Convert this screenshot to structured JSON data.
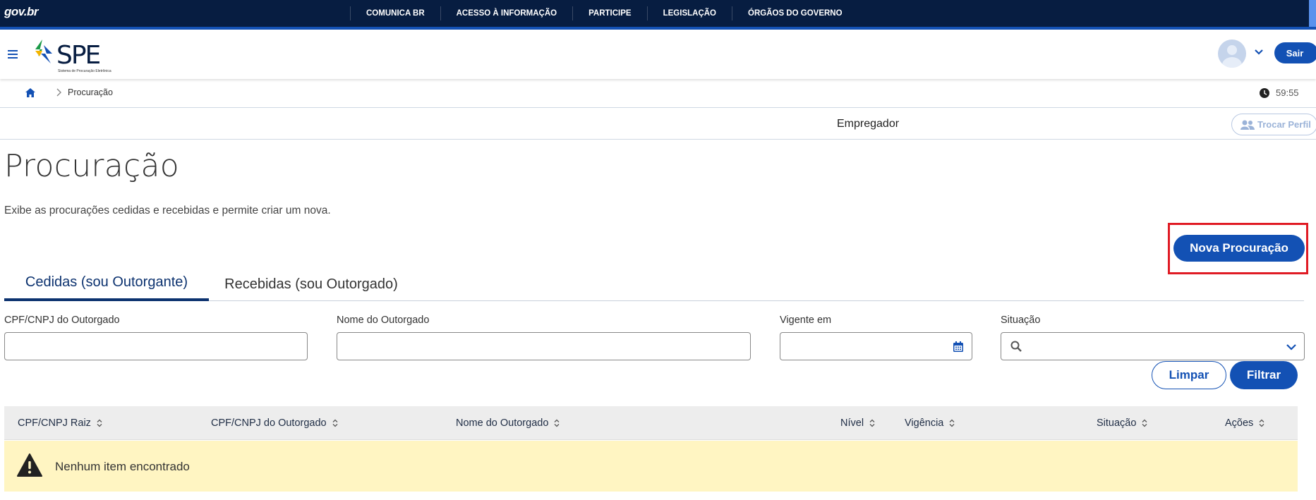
{
  "govbar": {
    "logo": "gov.br",
    "links": [
      "COMUNICA BR",
      "ACESSO À INFORMAÇÃO",
      "PARTICIPE",
      "LEGISLAÇÃO",
      "ÓRGÃOS DO GOVERNO"
    ]
  },
  "header": {
    "app_logo": "SPE",
    "app_logo_subtitle": "Sistema de Procuração Eletrônica",
    "logout_label": "Sair"
  },
  "breadcrumb": {
    "current": "Procuração",
    "timer": "59:55"
  },
  "profile": {
    "label": "Empregador",
    "switch_label": "Trocar Perfil"
  },
  "main": {
    "title": "Procuração",
    "description": "Exibe as procurações cedidas e recebidas e permite criar um nova.",
    "new_button_label": "Nova Procuração",
    "tabs": [
      {
        "label": "Cedidas (sou Outorgante)",
        "active": true
      },
      {
        "label": "Recebidas (sou Outorgado)",
        "active": false
      }
    ]
  },
  "filters": {
    "cpf_label": "CPF/CNPJ do Outorgado",
    "cpf_value": "",
    "nome_label": "Nome do Outorgado",
    "nome_value": "",
    "vigente_label": "Vigente em",
    "vigente_value": "",
    "situacao_label": "Situação",
    "situacao_value": "",
    "clear_label": "Limpar",
    "filter_label": "Filtrar"
  },
  "table": {
    "columns": [
      "CPF/CNPJ Raiz",
      "CPF/CNPJ do Outorgado",
      "Nome do Outorgado",
      "Nível",
      "Vigência",
      "Situação",
      "Ações"
    ],
    "empty_message": "Nenhum item encontrado"
  },
  "colors": {
    "gov_dark": "#071d41",
    "primary": "#1351b4",
    "highlight": "#e01b24",
    "warning_bg": "#fff5c2"
  }
}
